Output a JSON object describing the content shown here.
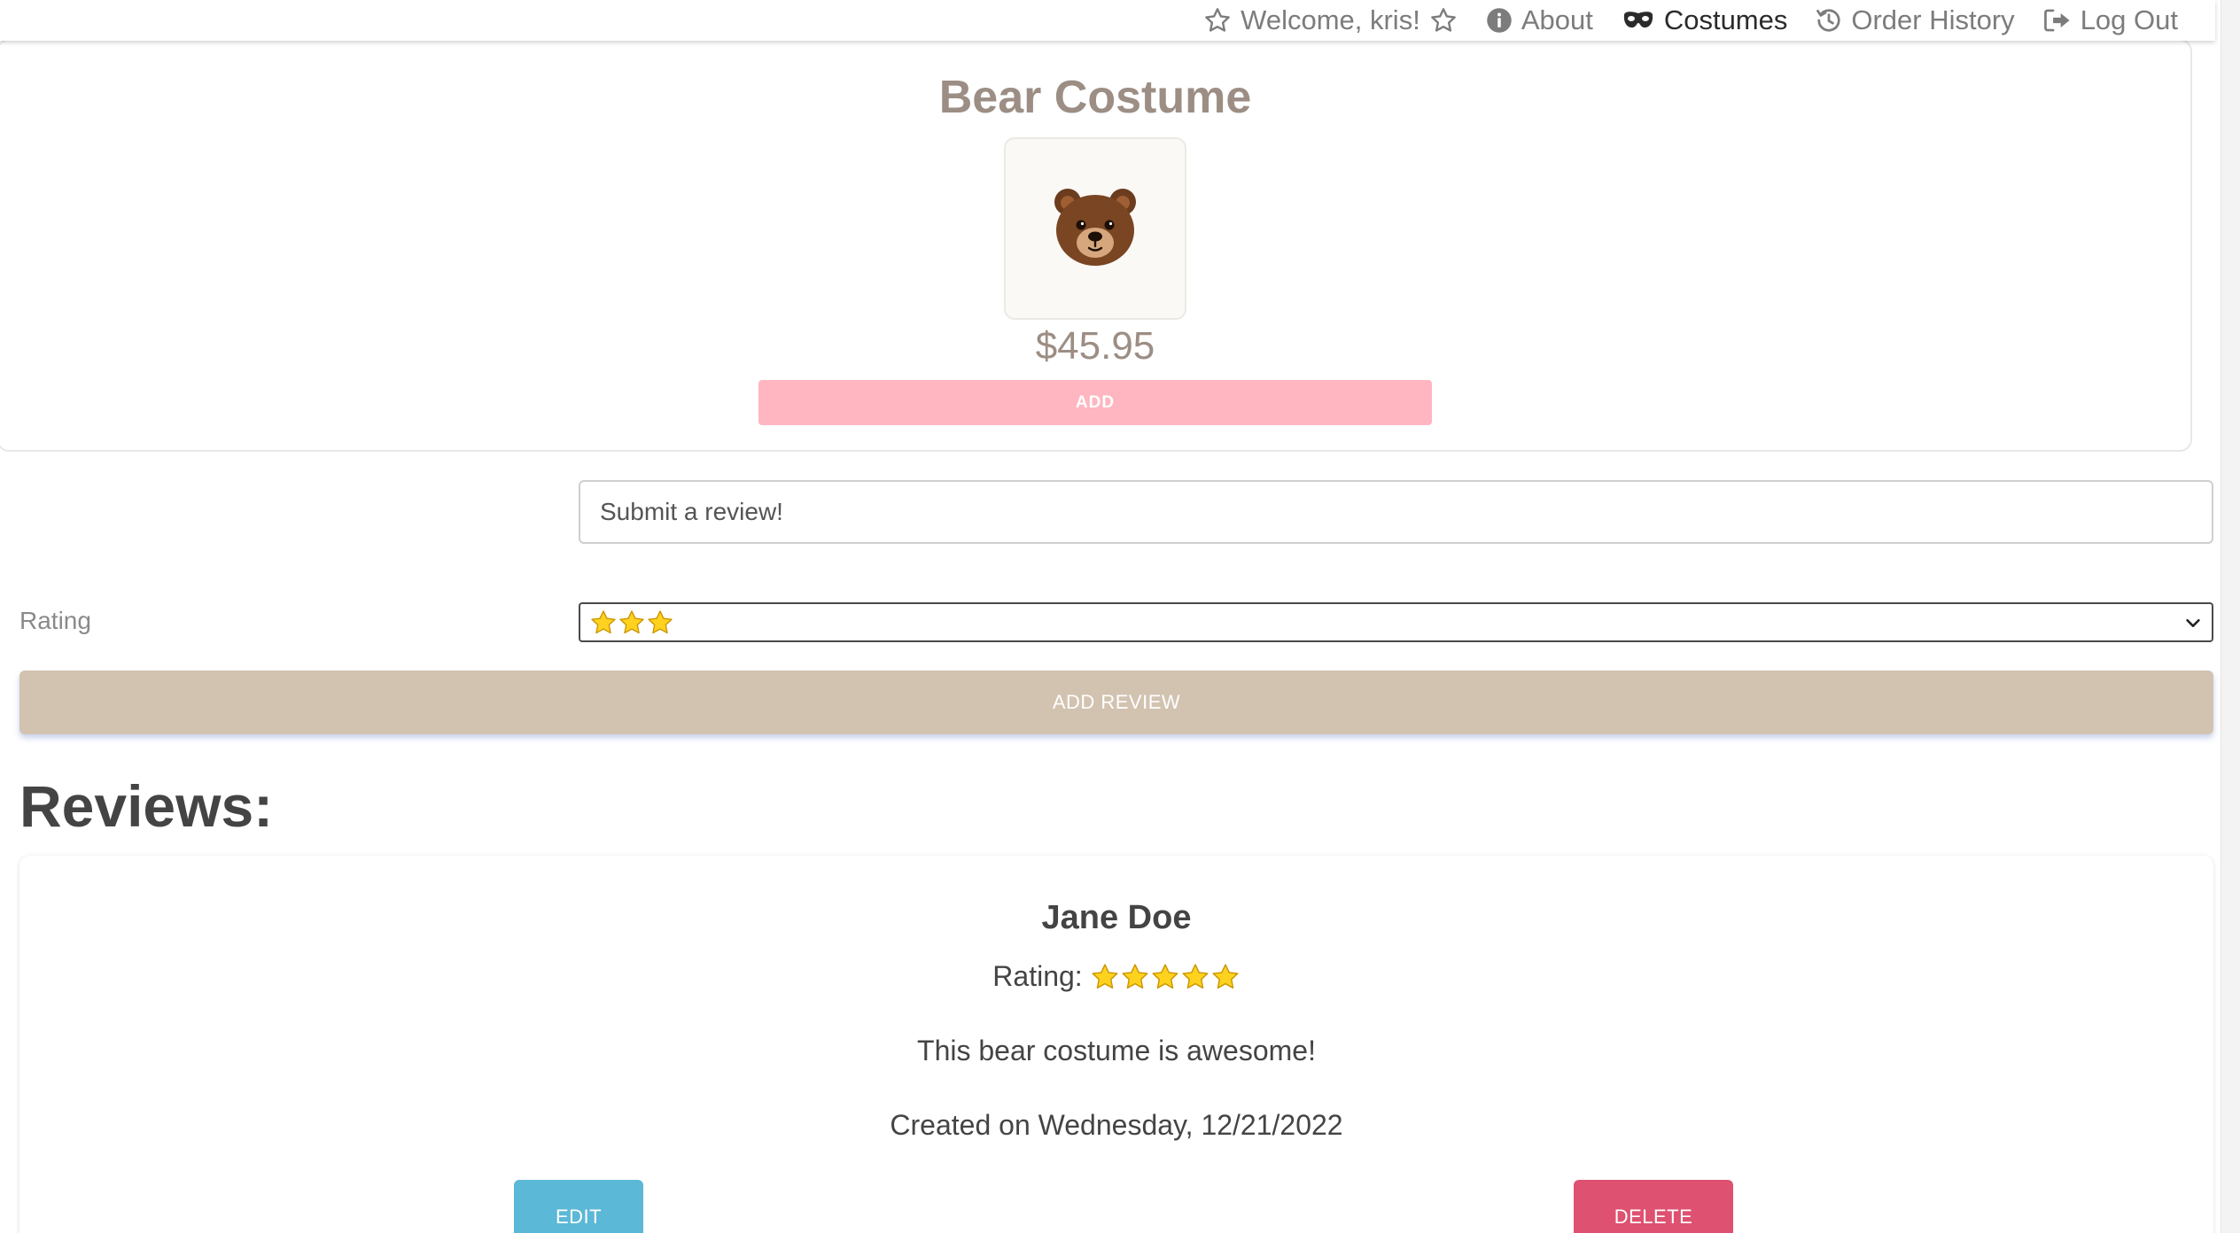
{
  "nav": {
    "welcome_text": "Welcome, kris!",
    "welcome_icon": "star-outline-icon",
    "items": [
      {
        "label": "About",
        "icon": "info-circle-icon",
        "active": false
      },
      {
        "label": "Costumes",
        "icon": "mask-icon",
        "active": true
      },
      {
        "label": "Order History",
        "icon": "history-icon",
        "active": false
      },
      {
        "label": "Log Out",
        "icon": "sign-out-icon",
        "active": false
      }
    ]
  },
  "product": {
    "title": "Bear Costume",
    "image_icon": "bear-face-icon",
    "price": "$45.95",
    "add_label": "ADD"
  },
  "review_form": {
    "placeholder": "Submit a review!",
    "rating_label": "Rating",
    "selected_rating": 3,
    "submit_label": "ADD REVIEW"
  },
  "reviews": {
    "heading": "Reviews:",
    "items": [
      {
        "name": "Jane Doe",
        "rating_label": "Rating:",
        "rating": 5,
        "text": "This bear costume is awesome!",
        "created": "Created on Wednesday, 12/21/2022",
        "edit_label": "EDIT",
        "delete_label": "DELETE"
      }
    ]
  },
  "colors": {
    "title_text": "#9c8e84",
    "add_button": "#ffb6c1",
    "add_review_button": "#d2c2b0",
    "edit_button": "#5bb8d6",
    "delete_button": "#de5170",
    "star_fill": "#ffd21f"
  }
}
